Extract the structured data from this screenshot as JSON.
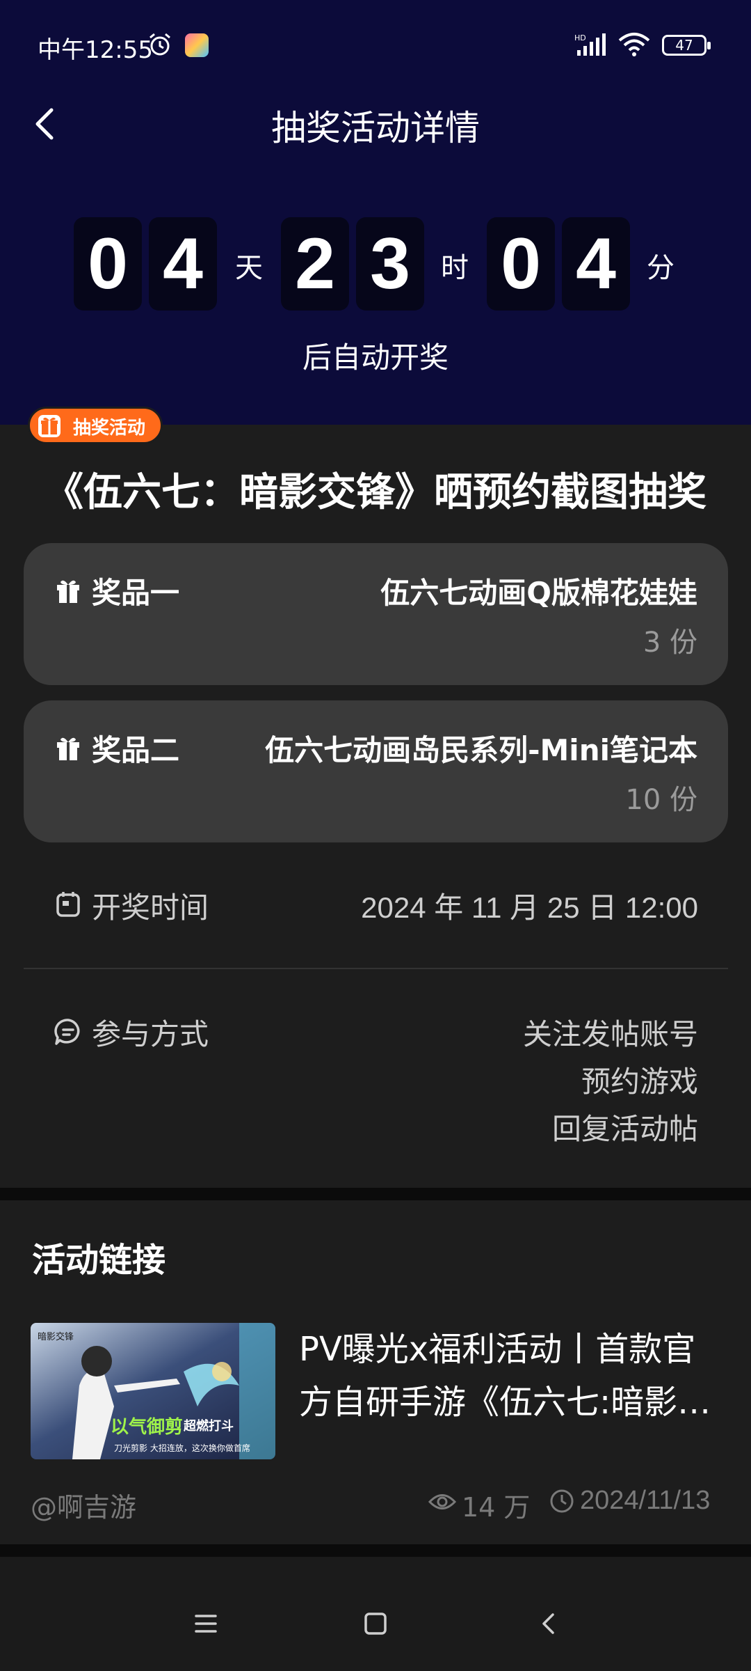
{
  "status": {
    "time": "中午12:55",
    "battery": "47"
  },
  "header": {
    "title": "抽奖活动详情"
  },
  "countdown": {
    "days": [
      "0",
      "4"
    ],
    "hours": [
      "2",
      "3"
    ],
    "minutes": [
      "0",
      "4"
    ],
    "day_unit": "天",
    "hour_unit": "时",
    "minute_unit": "分",
    "caption": "后自动开奖"
  },
  "event": {
    "tag": "抽奖活动",
    "title": "《伍六七：暗影交锋》晒预约截图抽奖",
    "prizes": [
      {
        "label": "奖品一",
        "name": "伍六七动画Q版棉花娃娃",
        "qty": "3 份"
      },
      {
        "label": "奖品二",
        "name": "伍六七动画岛民系列-Mini笔记本",
        "qty": "10 份"
      }
    ],
    "draw_time_label": "开奖时间",
    "draw_time_value": "2024 年 11 月 25 日 12:00",
    "join_label": "参与方式",
    "join_methods": [
      "关注发帖账号",
      "预约游戏",
      "回复活动帖"
    ]
  },
  "links": {
    "title": "活动链接",
    "article": {
      "title": "PV曝光x福利活动丨首款官方自研手游《伍六七:暗影…",
      "author": "@啊吉游",
      "views": "14 万",
      "date": "2024/11/13",
      "thumb_text": "以气御剪",
      "thumb_sub": "超燃打斗",
      "thumb_brand": "暗影交锋",
      "thumb_caption": "刀光剪影 大招连放，这次换你做首席"
    }
  },
  "colors": {
    "header_bg": "#0c0b3a",
    "accent": "#ff6a1a",
    "card_bg": "#3a3a3a"
  }
}
